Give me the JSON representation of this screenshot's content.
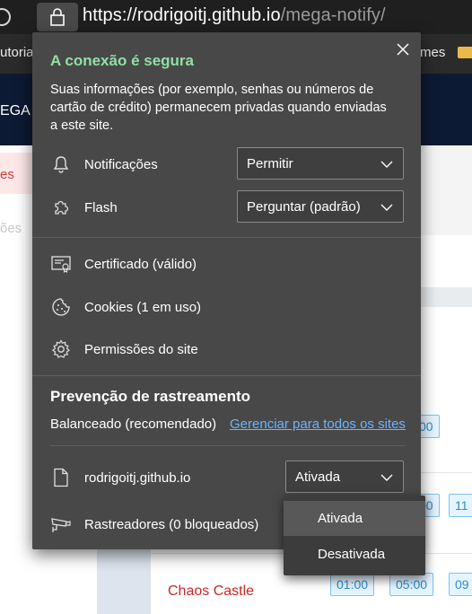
{
  "browser": {
    "url_host": "https://rodrigoitj.github.io",
    "url_path": "/mega-notify/",
    "bookmarks_left": "utoria",
    "bookmarks_right": "mes"
  },
  "page_behind": {
    "logo_text": "EGA",
    "sidebar_active": "es",
    "sidebar_item2": "ões",
    "times": [
      "00",
      "00",
      "11",
      "01:00",
      "05:00",
      "09"
    ],
    "event_name": "Chaos Castle"
  },
  "flyout": {
    "title": "A conexão é segura",
    "description": "Suas informações (por exemplo, senhas ou números de cartão de crédito) permanecem privadas quando enviadas a este site.",
    "permissions": [
      {
        "label": "Notificações",
        "value": "Permitir",
        "icon": "bell-icon"
      },
      {
        "label": "Flash",
        "value": "Perguntar (padrão)",
        "icon": "puzzle-icon"
      }
    ],
    "items": [
      {
        "label": "Certificado (válido)",
        "icon": "certificate-icon"
      },
      {
        "label": "Cookies (1 em uso)",
        "icon": "cookie-icon"
      },
      {
        "label": "Permissões do site",
        "icon": "gear-icon"
      }
    ],
    "tracking": {
      "title": "Prevenção de rastreamento",
      "level": "Balanceado (recomendado)",
      "manage_link": "Gerenciar para todos os sites",
      "site_name": "rodrigoitj.github.io",
      "site_status": "Ativada",
      "trackers": "Rastreadores (0 bloqueados)"
    }
  },
  "dropdown": {
    "options": [
      "Ativada",
      "Desativada"
    ],
    "highlighted": "Ativada"
  },
  "colors": {
    "secure_title": "#8fe0a4",
    "link": "#6ab4ff",
    "flyout_bg": "#484848"
  }
}
